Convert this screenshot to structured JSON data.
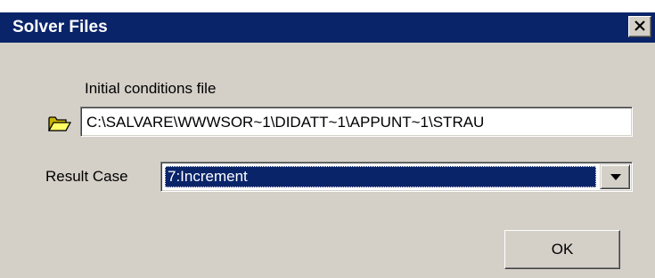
{
  "window": {
    "title": "Solver Files",
    "close_icon": "close-icon"
  },
  "initial_conditions": {
    "label": "Initial conditions file",
    "icon": "folder-open-icon",
    "value": "C:\\SALVARE\\WWWSOR~1\\DIDATT~1\\APPUNT~1\\STRAU"
  },
  "result_case": {
    "label": "Result Case",
    "selected": "7:Increment",
    "dropdown_icon": "chevron-down-icon"
  },
  "buttons": {
    "ok_label": "OK"
  },
  "colors": {
    "titlebar": "#0a246a",
    "face": "#d4d0c8",
    "selection": "#0a246a"
  }
}
